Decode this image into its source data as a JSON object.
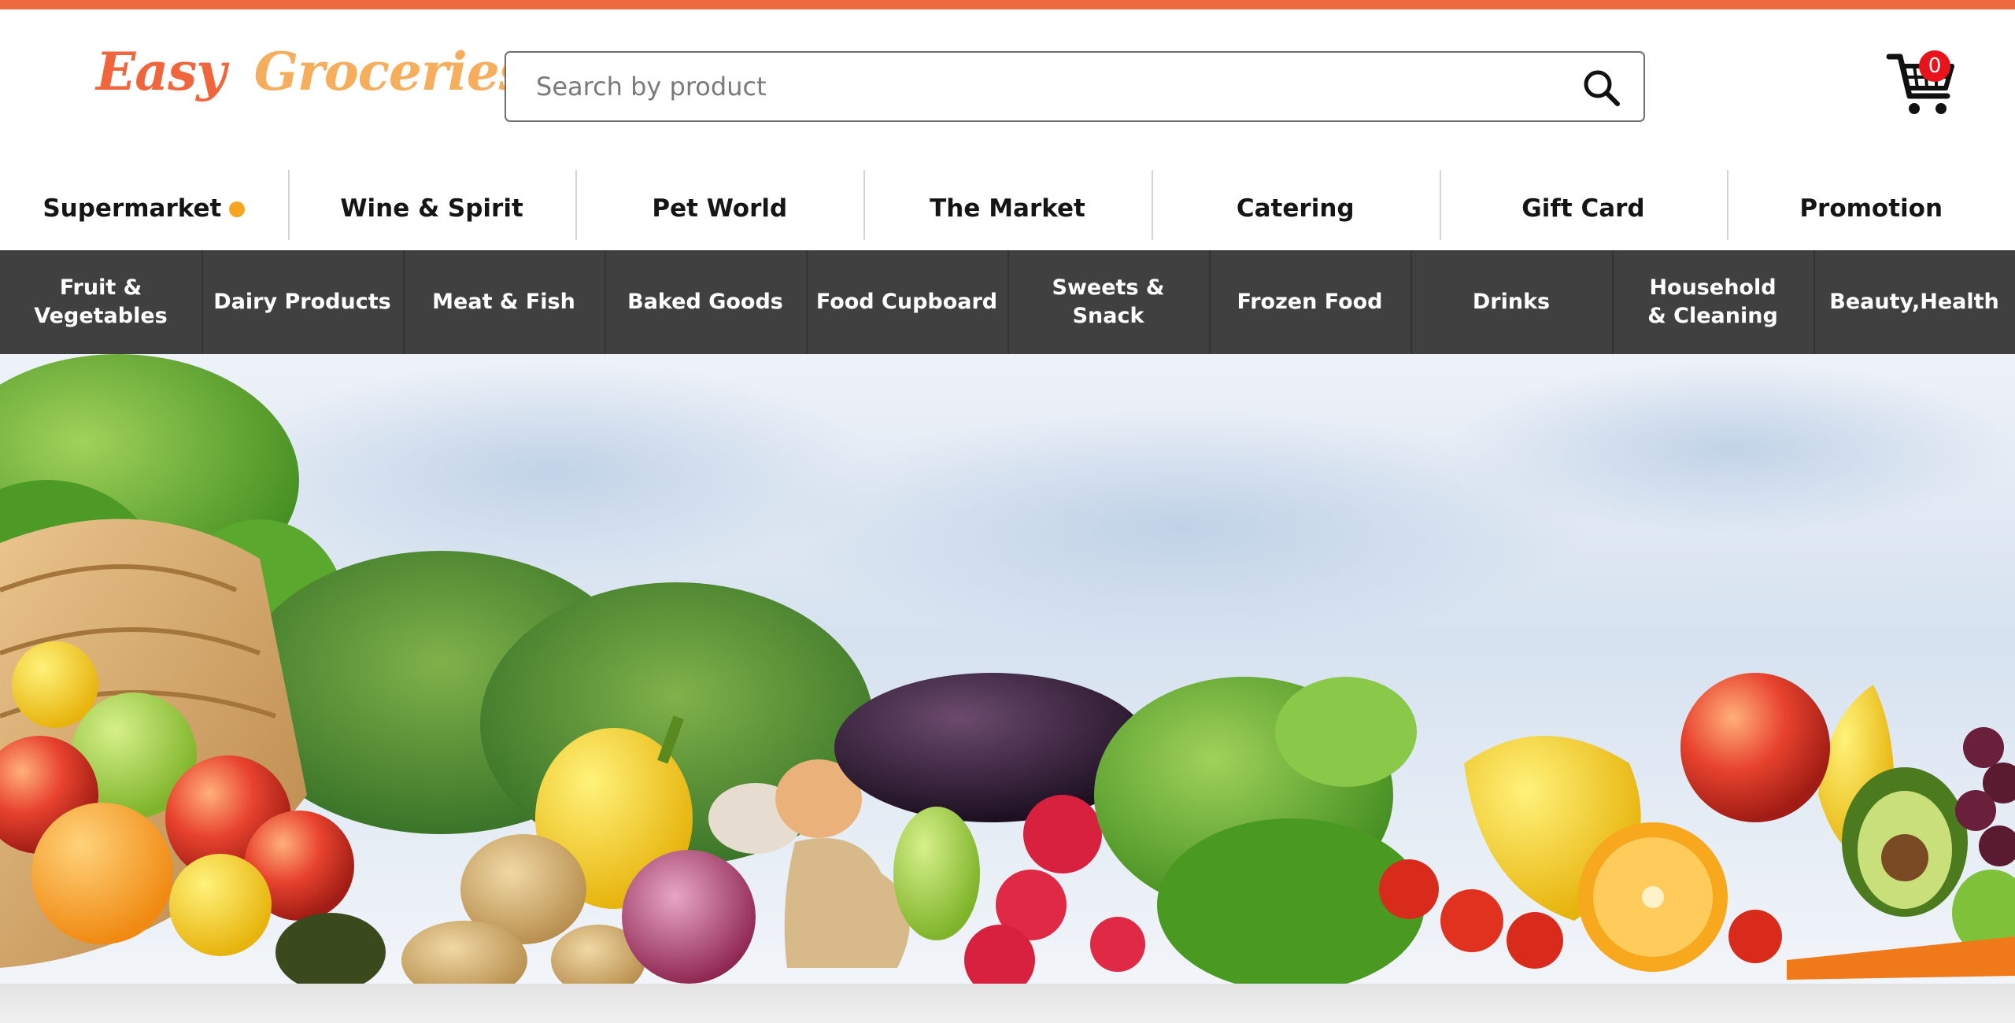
{
  "brand": {
    "name_part1": "Easy",
    "name_part2": "Groceries",
    "color_primary": "#f0653c",
    "color_secondary": "#f6ad5c"
  },
  "search": {
    "placeholder": "Search by product",
    "value": "",
    "button_icon": "search-icon"
  },
  "cart": {
    "icon": "cart-icon",
    "count": "0",
    "badge_color": "#e8131b"
  },
  "main_nav": {
    "items": [
      {
        "label": "Supermarket",
        "active": true
      },
      {
        "label": "Wine & Spirit"
      },
      {
        "label": "Pet World"
      },
      {
        "label": "The Market"
      },
      {
        "label": "Catering"
      },
      {
        "label": "Gift Card"
      },
      {
        "label": "Promotion"
      }
    ],
    "active_dot_color": "#f6a623"
  },
  "category_nav": {
    "items": [
      {
        "label": "Fruit & Vegetables"
      },
      {
        "label": "Dairy Products"
      },
      {
        "label": "Meat & Fish"
      },
      {
        "label": "Baked Goods"
      },
      {
        "label": "Food Cupboard"
      },
      {
        "label": "Sweets & Snack"
      },
      {
        "label": "Frozen Food"
      },
      {
        "label": "Drinks"
      },
      {
        "label": "Household & Cleaning"
      },
      {
        "label": "Beauty,Health"
      }
    ],
    "background_color": "#404040"
  },
  "hero": {
    "image": "fresh-produce-banner"
  },
  "colors": {
    "accent_strip": "#ee6a3f"
  }
}
